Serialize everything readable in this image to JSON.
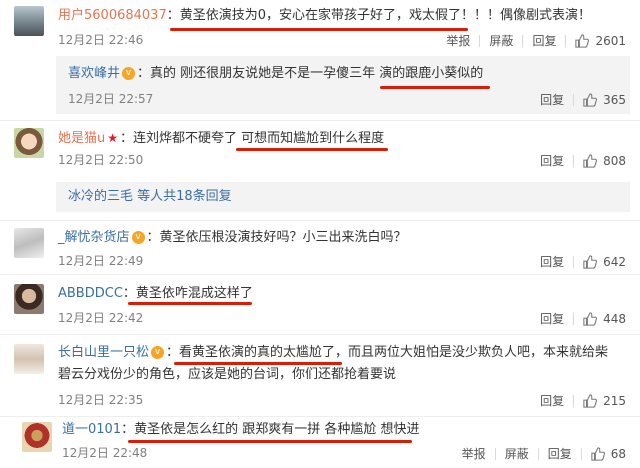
{
  "actions": {
    "report": "举报",
    "block": "屏蔽",
    "reply": "回复"
  },
  "comments": [
    {
      "user": "用户5600684037",
      "text": "：黄圣依演技为0，安心在家带孩子好了，戏太假了！！！偶像剧式表演！",
      "time": "12月2日 22:46",
      "likes": "2601"
    },
    {
      "user": "喜欢峰井",
      "text": "：真的 刚还很朋友说她是不是一孕傻三年 演的跟鹿小葵似的",
      "time": "12月2日 22:57",
      "likes": "365"
    },
    {
      "user": "她是猫u",
      "text": "：连刘烨都不硬夸了 可想而知尴尬到什么程度",
      "time": "12月2日 22:50",
      "likes": "808"
    },
    {
      "more_users": "冰冷的三毛 等人",
      "more_count": "共18条回复"
    },
    {
      "user": "_解忧杂货店",
      "text": "：黄圣依压根没演技好吗？小三出来洗白吗？",
      "time": "12月2日 22:49",
      "likes": "642"
    },
    {
      "user": "ABBDDCC",
      "text": "：黄圣依咋混成这样了",
      "time": "12月2日 22:42",
      "likes": "448"
    },
    {
      "user": "长白山里一只松",
      "text": "：看黄圣依演的真的太尴尬了，而且两位大姐怕是没少欺负人吧，本来就给柴",
      "text2": "碧云分戏份少的角色，应该是她的台词，你们还都抢着要说",
      "time": "12月2日 22:35",
      "likes": "215"
    },
    {
      "user": "道一0101",
      "text": "：黄圣依是怎么红的 跟郑爽有一拼 各种尴尬 想快进",
      "time": "12月2日 22:48",
      "likes": "68"
    }
  ],
  "colors": {
    "username": "#eb7350",
    "highlight": "#d81e06",
    "reply_bg": "#f3f3f3"
  }
}
